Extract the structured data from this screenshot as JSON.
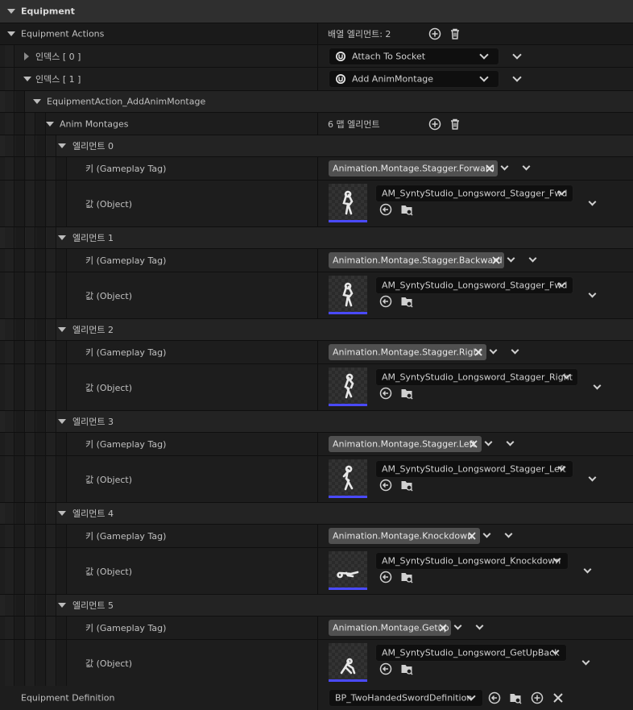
{
  "equipment_header": "Equipment",
  "equipment_actions": {
    "label": "Equipment Actions",
    "count_text": "배열 엘리먼트: 2",
    "items": [
      {
        "label": "인덱스 [ 0 ]",
        "value": "Attach To Socket"
      },
      {
        "label": "인덱스 [ 1 ]",
        "value": "Add AnimMontage"
      }
    ],
    "action_name": "EquipmentAction_AddAnimMontage"
  },
  "anim_montages": {
    "label": "Anim Montages",
    "count_text": "6 맵 엘리먼트",
    "key_label": "키 (Gameplay Tag)",
    "value_label": "값 (Object)",
    "elements": [
      {
        "label": "엘리먼트 0",
        "tag": "Animation.Montage.Stagger.Forward",
        "asset": "AM_SyntyStudio_Longsword_Stagger_Fwd"
      },
      {
        "label": "엘리먼트 1",
        "tag": "Animation.Montage.Stagger.Backward",
        "asset": "AM_SyntyStudio_Longsword_Stagger_Fwd"
      },
      {
        "label": "엘리먼트 2",
        "tag": "Animation.Montage.Stagger.Right",
        "asset": "AM_SyntyStudio_Longsword_Stagger_Right"
      },
      {
        "label": "엘리먼트 3",
        "tag": "Animation.Montage.Stagger.Left",
        "asset": "AM_SyntyStudio_Longsword_Stagger_Left"
      },
      {
        "label": "엘리먼트 4",
        "tag": "Animation.Montage.Knockdown",
        "asset": "AM_SyntyStudio_Longsword_Knockdown"
      },
      {
        "label": "엘리먼트 5",
        "tag": "Animation.Montage.Getup",
        "asset": "AM_SyntyStudio_Longsword_GetUpBack"
      }
    ]
  },
  "equipment_definition": {
    "label": "Equipment Definition",
    "value": "BP_TwoHandedSwordDefinition"
  },
  "colors": {
    "thumbnail_underline": "#4a4aff",
    "tag_background": "#505050",
    "category_background": "#2f2f2f"
  }
}
